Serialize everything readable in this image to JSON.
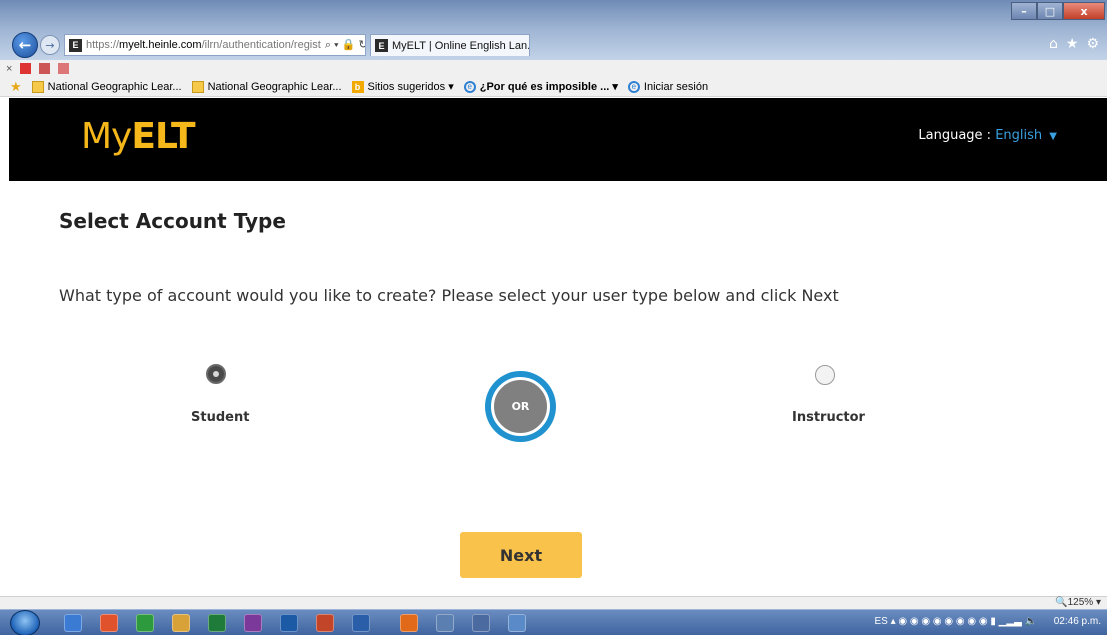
{
  "browser": {
    "url_prefix": "https://",
    "url_host": "myelt.heinle.com",
    "url_path": "/ilrn/authentication/regist",
    "tab_title": "MyELT | Online English Lan...",
    "tab_close": "×",
    "favicon_letter": "E",
    "favorites": [
      {
        "label": "National Geographic Lear..."
      },
      {
        "label": "National Geographic Lear..."
      },
      {
        "label": "Sitios sugeridos ▾"
      },
      {
        "label": "¿Por qué es imposible ... ▾"
      },
      {
        "label": "Iniciar sesión"
      }
    ],
    "zoom": "125%",
    "tray_lang": "ES",
    "clock": "02:46 p.m."
  },
  "header": {
    "logo_my": "My",
    "logo_elt": "ELT",
    "language_label": "Language :",
    "language_value": "English"
  },
  "main": {
    "title": "Select Account Type",
    "instructions": "What type of account would you like to create? Please select your user type below and click Next",
    "student_label": "Student",
    "instructor_label": "Instructor",
    "or_label": "OR",
    "selected": "student",
    "next_label": "Next"
  },
  "colors": {
    "brand_yellow": "#f6b71b",
    "button_yellow": "#f9c24a",
    "accent_blue": "#1f92cf"
  }
}
